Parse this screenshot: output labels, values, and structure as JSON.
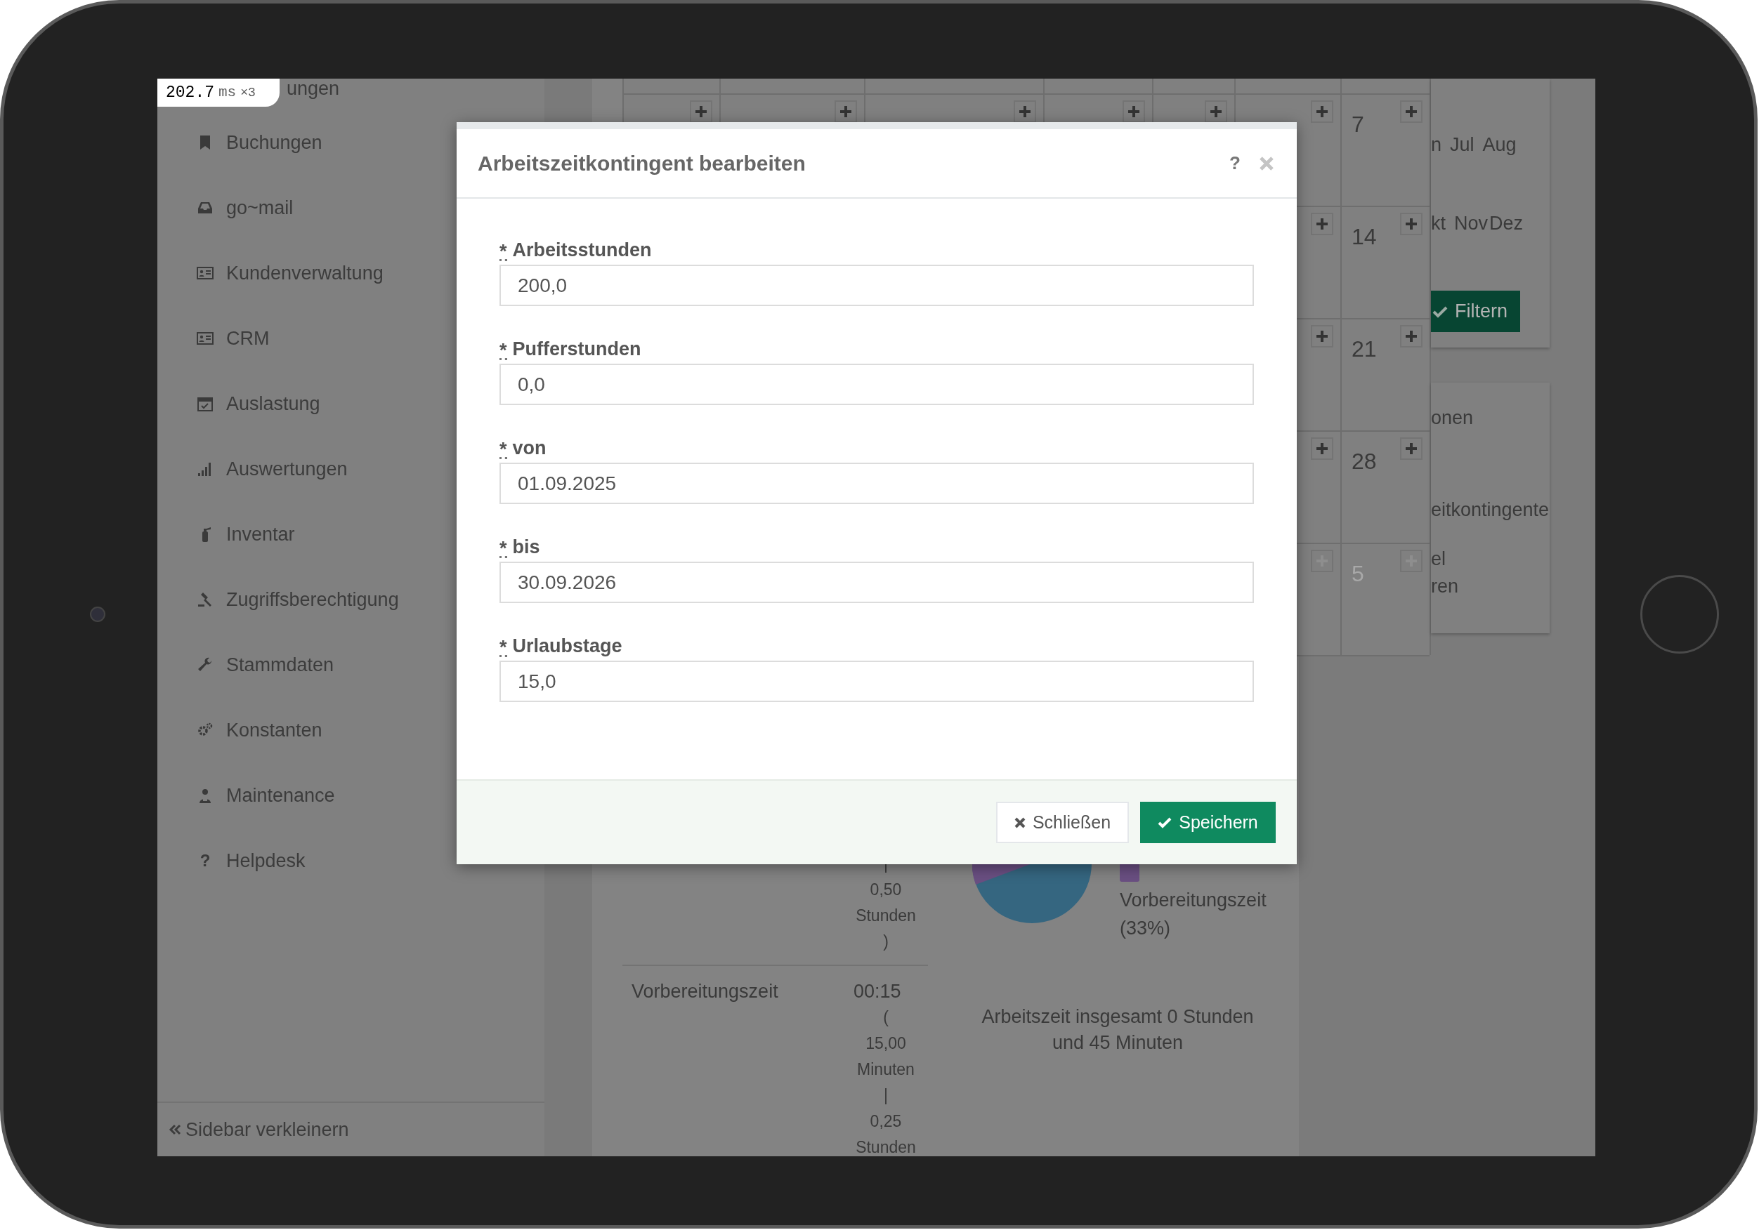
{
  "perf_badge": {
    "value": "202.7",
    "unit": "ms",
    "count": "×3"
  },
  "sidebar": {
    "partial_item": "ungen",
    "items": [
      {
        "label": "Buchungen"
      },
      {
        "label": "go~mail"
      },
      {
        "label": "Kundenverwaltung"
      },
      {
        "label": "CRM"
      },
      {
        "label": "Auslastung"
      },
      {
        "label": "Auswertungen"
      },
      {
        "label": "Inventar"
      },
      {
        "label": "Zugriffsberechtigung"
      },
      {
        "label": "Stammdaten"
      },
      {
        "label": "Konstanten"
      },
      {
        "label": "Maintenance"
      },
      {
        "label": "Helpdesk",
        "glyph": "?"
      }
    ],
    "collapse": "Sidebar verkleinern"
  },
  "calendar": {
    "weeks": [
      {
        "days": [
          {
            "label": "7",
            "muted": false
          }
        ]
      },
      {
        "days": [
          {
            "label": "14",
            "muted": false
          }
        ]
      },
      {
        "days": [
          {
            "label": "21",
            "muted": false
          }
        ]
      },
      {
        "days": [
          {
            "label": "28",
            "muted": false
          }
        ]
      },
      {
        "days": [
          {
            "label": "5",
            "muted": true
          }
        ]
      }
    ]
  },
  "filter_card": {
    "month_rows": [
      [
        "n",
        "Jul",
        "Aug"
      ],
      [
        "kt",
        "Nov",
        "Dez"
      ]
    ],
    "button": "Filtern"
  },
  "links_card": {
    "items": [
      "onen",
      "eitkontingente",
      "el",
      "ren"
    ]
  },
  "times_table": {
    "rows": [
      {
        "lines": [
          "|",
          "0,50",
          "Stunden",
          ")"
        ]
      },
      {
        "label": "Vorbereitungszeit",
        "lines": [
          "00:15",
          "(",
          "15,00",
          "Minuten",
          "|",
          "0,25",
          "Stunden"
        ]
      }
    ]
  },
  "pie": {
    "legend": [
      {
        "label": "Vorbereitungszeit (33%)",
        "color": "#6a4f82"
      }
    ]
  },
  "summary": "Arbeitszeit insgesamt 0 Stunden und 45 Minuten",
  "modal": {
    "title": "Arbeitszeitkontingent bearbeiten",
    "help": "?",
    "fields": [
      {
        "marker": "*",
        "label": "Arbeitsstunden",
        "value": "200,0"
      },
      {
        "marker": "*",
        "label": "Pufferstunden",
        "value": "0,0"
      },
      {
        "marker": "*",
        "label": "von",
        "value": "01.09.2025"
      },
      {
        "marker": "*",
        "label": "bis",
        "value": "30.09.2026"
      },
      {
        "marker": "*",
        "label": "Urlaubstage",
        "value": "15,0"
      }
    ],
    "buttons": [
      {
        "label": "Schließen",
        "kind": "close"
      },
      {
        "label": "Speichern",
        "kind": "save"
      }
    ]
  }
}
